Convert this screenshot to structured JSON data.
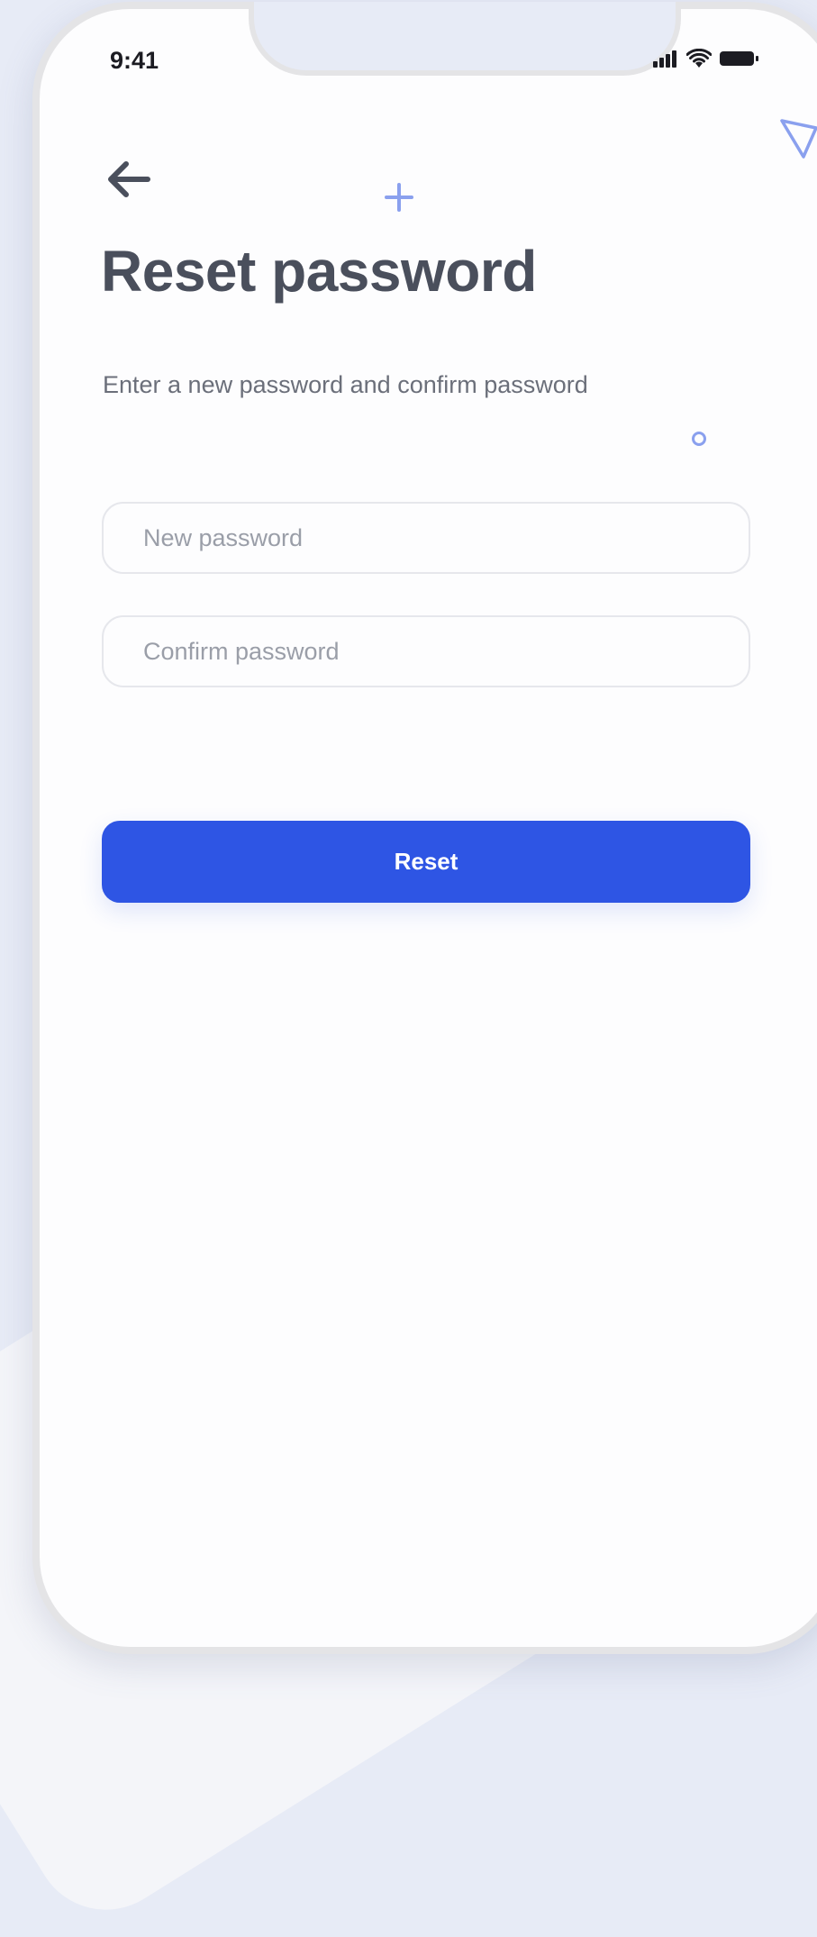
{
  "status_bar": {
    "time": "9:41",
    "icons": [
      "signal-icon",
      "wifi-icon",
      "battery-icon"
    ]
  },
  "header": {
    "back_icon": "arrow-left-icon"
  },
  "page": {
    "title": "Reset password",
    "subtitle": "Enter a new password and confirm password"
  },
  "form": {
    "new_password": {
      "value": "",
      "placeholder": "New password"
    },
    "confirm_password": {
      "value": "",
      "placeholder": "Confirm password"
    },
    "submit_label": "Reset"
  },
  "colors": {
    "primary": "#2e55e4",
    "title": "#4a4f5c",
    "subtitle": "#6b6f7a",
    "placeholder": "#9a9ea8",
    "background": "#e7ebf6",
    "accent_decor": "#8aa0ee"
  },
  "decorations": [
    "plus-icon",
    "triangle-icon",
    "circle-icon"
  ]
}
